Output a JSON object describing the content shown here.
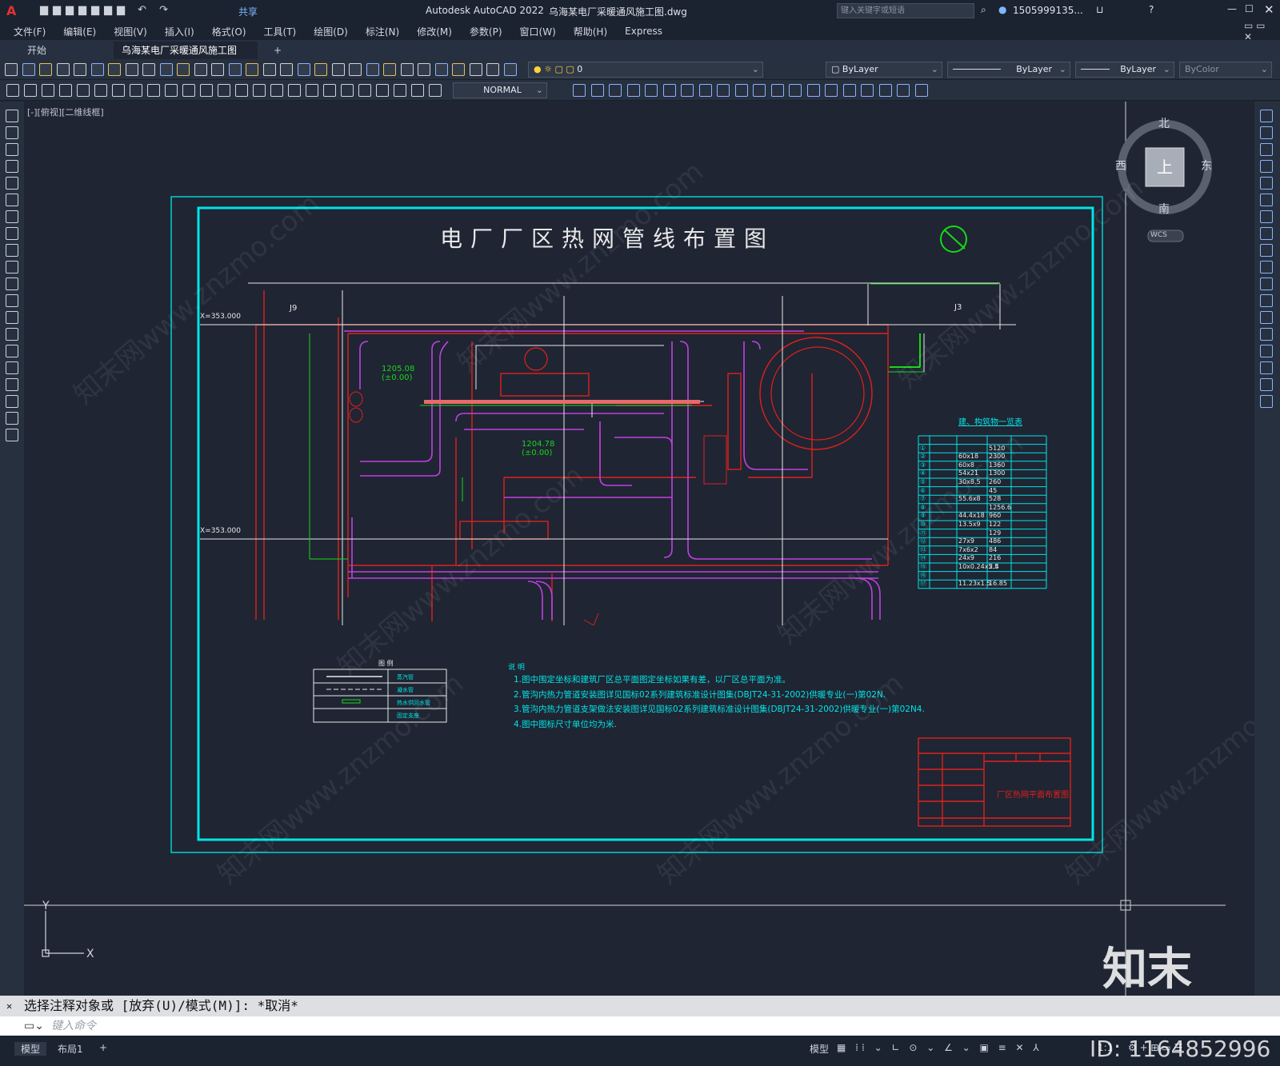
{
  "app": {
    "title": "Autodesk AutoCAD 2022",
    "filename": "乌海某电厂采暖通风施工图.dwg",
    "search_placeholder": "键入关键字或短语",
    "user": "1505999135...",
    "share": "共享"
  },
  "menu": [
    "文件(F)",
    "编辑(E)",
    "视图(V)",
    "插入(I)",
    "格式(O)",
    "工具(T)",
    "绘图(D)",
    "标注(N)",
    "修改(M)",
    "参数(P)",
    "窗口(W)",
    "帮助(H)",
    "Express"
  ],
  "tabs": {
    "start": "开始",
    "active": "乌海某电厂采暖通风施工图*",
    "add": "+"
  },
  "toolbar": {
    "layer_value": "0",
    "color": "ByLayer",
    "linetype": "ByLayer",
    "lineweight": "ByLayer",
    "plotstyle": "ByColor",
    "dimstyle": "NORMAL"
  },
  "viewport_label": "[-][俯视][二维线框]",
  "viewcube": {
    "n": "北",
    "s": "南",
    "e": "东",
    "w": "西",
    "top": "上",
    "wcs": "WCS"
  },
  "drawing": {
    "title": "电厂厂区热网管线布置图",
    "coord_top": "X=353.000",
    "coord_bottom": "X=353.000",
    "label_j9": "J9",
    "label_j3": "J3",
    "elev1": "1205.08",
    "elev1b": "(±0.00)",
    "elev2": "1204.78",
    "elev2b": "(±0.00)",
    "table_title": "建、构筑物一览表",
    "table_rows": [
      [
        "①",
        "",
        "",
        "5120",
        ""
      ],
      [
        "②",
        "",
        "60x18",
        "2300",
        ""
      ],
      [
        "③",
        "",
        "60x8",
        "1360",
        ""
      ],
      [
        "④",
        "",
        "54x21",
        "1300",
        ""
      ],
      [
        "⑤",
        "",
        "30x8.5",
        "260",
        ""
      ],
      [
        "⑥",
        "",
        "",
        "45",
        ""
      ],
      [
        "⑦",
        "",
        "55.6x8",
        "528",
        ""
      ],
      [
        "⑧",
        "",
        "",
        "1256.6",
        ""
      ],
      [
        "⑨",
        "",
        "44.4x18",
        "960",
        ""
      ],
      [
        "⑩",
        "",
        "13.5x9",
        "122",
        ""
      ],
      [
        "⑪",
        "",
        "",
        "129",
        ""
      ],
      [
        "⑫",
        "",
        "27x9",
        "486",
        ""
      ],
      [
        "⑬",
        "",
        "7x6x2",
        "84",
        ""
      ],
      [
        "⑭",
        "",
        "24x9",
        "216",
        ""
      ],
      [
        "⑮",
        "",
        "10x0.24x5.5",
        "2.4",
        ""
      ],
      [
        "⑯",
        "",
        "",
        "",
        ""
      ],
      [
        "⑰",
        "",
        "11.23x1.5",
        "16.85",
        ""
      ]
    ],
    "notes_title": "说 明",
    "notes": [
      "1.图中围定坐标和建筑厂区总平面图定坐标如果有差，以厂区总平面为准。",
      "2.管沟内热力管道安装图详见国标02系列建筑标准设计图集(DBJT24-31-2002)供暖专业(一)第02N.",
      "3.管沟内热力管道支架做法安装图详见国标02系列建筑标准设计图集(DBJT24-31-2002)供暖专业(一)第02N4.",
      "4.图中图标尺寸单位均为米."
    ],
    "legend_title": "图 例",
    "legend": [
      "蒸汽管",
      "凝水管",
      "热水供回水管",
      "固定支座"
    ],
    "titleblock": "厂区热网平面布置图"
  },
  "command": {
    "prompt": "选择注释对象或 [放弃(U)/模式(M)]: *取消*",
    "input_placeholder": "键入命令"
  },
  "status": {
    "model": "模型",
    "layout1": "布局1",
    "add": "+",
    "model_btn": "模型",
    "scale": "1:1"
  },
  "watermark": {
    "brand": "知末",
    "id": "ID: 1164852996",
    "site": "知末网www.znzmo.com"
  },
  "colors": {
    "bg": "#1f2533",
    "cyan": "#00e5e5",
    "red": "#e0201c",
    "magenta": "#c040e0",
    "green": "#18d818",
    "white": "#e8e8e8"
  }
}
